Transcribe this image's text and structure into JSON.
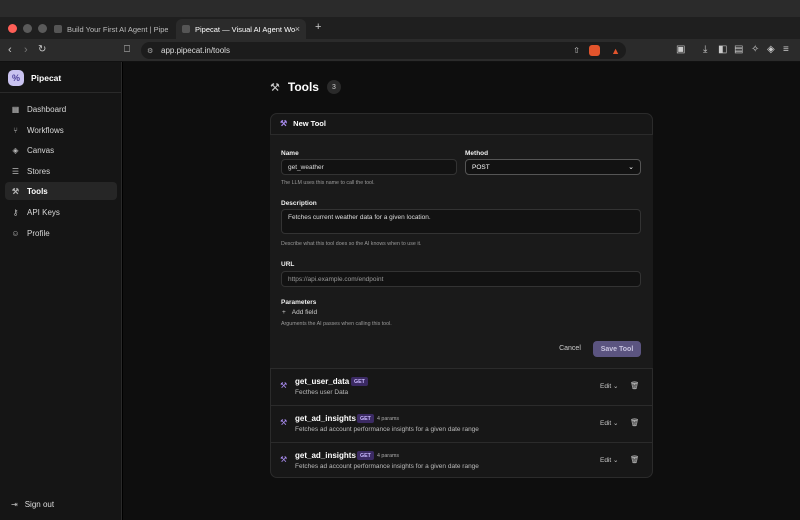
{
  "browser": {
    "tabs": [
      {
        "title": "Build Your First AI Agent | Pipecat",
        "active": false
      },
      {
        "title": "Pipecat — Visual AI Agent Wo...",
        "active": true
      }
    ],
    "new_tab": "+",
    "url": "app.pipecat.in/tools"
  },
  "sidebar": {
    "brand": "Pipecat",
    "items": [
      {
        "label": "Dashboard",
        "icon": "grid-icon"
      },
      {
        "label": "Workflows",
        "icon": "workflow-icon"
      },
      {
        "label": "Canvas",
        "icon": "layers-icon"
      },
      {
        "label": "Stores",
        "icon": "database-icon"
      },
      {
        "label": "Tools",
        "icon": "wrench-icon",
        "active": true
      },
      {
        "label": "API Keys",
        "icon": "key-icon"
      },
      {
        "label": "Profile",
        "icon": "user-icon"
      }
    ],
    "signout": "Sign out"
  },
  "page": {
    "title": "Tools",
    "count": "3"
  },
  "new_tool": {
    "header": "New Tool",
    "name_label": "Name",
    "name_value": "get_weather",
    "name_help": "The LLM uses this name to call the tool.",
    "method_label": "Method",
    "method_value": "POST",
    "description_label": "Description",
    "description_value": "Fetches current weather data for a given location.",
    "description_help": "Describe what this tool does so the AI knows when to use it.",
    "url_label": "URL",
    "url_placeholder": "https://api.example.com/endpoint",
    "parameters_label": "Parameters",
    "add_field": "Add field",
    "parameters_help": "Arguments the AI passes when calling this tool.",
    "cancel": "Cancel",
    "save": "Save Tool"
  },
  "tools": [
    {
      "name": "get_user_data",
      "method": "GET",
      "params": "",
      "description": "Fecthes user Data",
      "edit": "Edit"
    },
    {
      "name": "get_ad_insights",
      "method": "GET",
      "params": "4 params",
      "description": "Fetches ad account performance insights for a given date range",
      "edit": "Edit"
    },
    {
      "name": "get_ad_insights",
      "method": "GET",
      "params": "4 params",
      "description": "Fetches ad account performance insights for a given date range",
      "edit": "Edit"
    }
  ],
  "colors": {
    "accent": "#a98cf0",
    "save_button": "#5b5480",
    "background": "#0e0e0e"
  }
}
